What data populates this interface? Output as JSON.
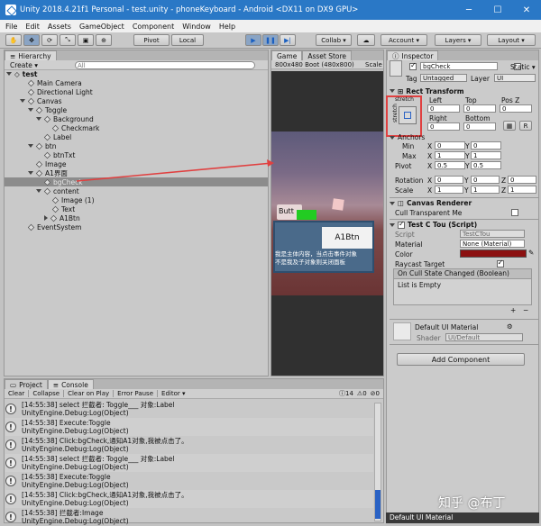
{
  "window": {
    "title": "Unity 2018.4.21f1 Personal - test.unity - phoneKeyboard - Android <DX11 on DX9 GPU>",
    "minimize": "─",
    "maximize": "☐",
    "close": "✕"
  },
  "menu": [
    "File",
    "Edit",
    "Assets",
    "GameObject",
    "Component",
    "Window",
    "Help"
  ],
  "toolbar": {
    "pivot": "Pivot",
    "local": "Local",
    "collab": "Collab ▾",
    "account": "Account ▾",
    "layers": "Layers ▾",
    "layout": "Layout ▾"
  },
  "hierarchy": {
    "tab": "Hierarchy",
    "create": "Create ▾",
    "search_placeholder": "All",
    "scene": "test",
    "items": [
      {
        "label": "Main Camera",
        "depth": 1,
        "arrow": ""
      },
      {
        "label": "Directional Light",
        "depth": 1,
        "arrow": ""
      },
      {
        "label": "Canvas",
        "depth": 1,
        "arrow": "down"
      },
      {
        "label": "Toggle",
        "depth": 2,
        "arrow": "down"
      },
      {
        "label": "Background",
        "depth": 3,
        "arrow": "down"
      },
      {
        "label": "Checkmark",
        "depth": 4,
        "arrow": ""
      },
      {
        "label": "Label",
        "depth": 3,
        "arrow": ""
      },
      {
        "label": "btn",
        "depth": 2,
        "arrow": "down"
      },
      {
        "label": "btnTxt",
        "depth": 3,
        "arrow": ""
      },
      {
        "label": "Image",
        "depth": 2,
        "arrow": ""
      },
      {
        "label": "A1界面",
        "depth": 2,
        "arrow": "down"
      },
      {
        "label": "bgCheck",
        "depth": 3,
        "arrow": "",
        "selected": true
      },
      {
        "label": "content",
        "depth": 3,
        "arrow": "down"
      },
      {
        "label": "Image (1)",
        "depth": 4,
        "arrow": ""
      },
      {
        "label": "Text",
        "depth": 4,
        "arrow": ""
      },
      {
        "label": "A1Btn",
        "depth": 4,
        "arrow": "right"
      },
      {
        "label": "EventSystem",
        "depth": 1,
        "arrow": ""
      }
    ]
  },
  "game": {
    "tab_game": "Game",
    "tab_asset": "Asset Store",
    "resolution": "800x480 Boot (480x800)",
    "scale": "Scale",
    "button_text": "Butt",
    "a1btn": "A1Btn",
    "message_line1": "我是主体内容，当点击事件对象",
    "message_line2": "不是我及子对象则关闭面板"
  },
  "inspector": {
    "tab": "Inspector",
    "object_name": "bgCheck",
    "static": "Static ▾",
    "tag_label": "Tag",
    "tag_value": "Untagged",
    "layer_label": "Layer",
    "layer_value": "UI",
    "rect": {
      "title": "Rect Transform",
      "stretch_top": "stretch",
      "stretch_side": "stretch",
      "left": "Left",
      "top": "Top",
      "posz": "Pos Z",
      "left_v": "0",
      "top_v": "0",
      "posz_v": "0",
      "right": "Right",
      "bottom": "Bottom",
      "right_v": "0",
      "bottom_v": "0",
      "r_btn": "R"
    },
    "anchors": {
      "title": "Anchors",
      "min": "Min",
      "max": "Max",
      "pivot": "Pivot",
      "x": "X",
      "y": "Y",
      "min_x": "0",
      "min_y": "0",
      "max_x": "1",
      "max_y": "1",
      "pivot_x": "0.5",
      "pivot_y": "0.5"
    },
    "rotation": {
      "label": "Rotation",
      "x": "0",
      "y": "0",
      "z": "0"
    },
    "scale": {
      "label": "Scale",
      "x": "1",
      "y": "1",
      "z": "1"
    },
    "canvas_renderer": {
      "title": "Canvas Renderer",
      "cull": "Cull Transparent Me"
    },
    "script_comp": {
      "title": "Test C Tou (Script)",
      "script_label": "Script",
      "script_value": "TestCTou",
      "material_label": "Material",
      "material_value": "None (Material)",
      "color_label": "Color",
      "raycast_label": "Raycast Target",
      "event_title": "On Cull State Changed (Boolean)",
      "list_empty": "List is Empty",
      "plus": "+",
      "minus": "−"
    },
    "material": {
      "name": "Default UI Material",
      "shader_label": "Shader",
      "shader_value": "UI/Default"
    },
    "add_component": "Add Component",
    "footer": "Default UI Material"
  },
  "console": {
    "tab_project": "Project",
    "tab_console": "Console",
    "clear": "Clear",
    "collapse": "Collapse",
    "clear_on_play": "Clear on Play",
    "error_pause": "Error Pause",
    "editor": "Editor ▾",
    "count_info": "14",
    "count_warn": "0",
    "count_err": "0",
    "logs": [
      {
        "l1": "[14:55:38] select 拦截者: Toggle___ 对象:Label",
        "l2": "UnityEngine.Debug:Log(Object)"
      },
      {
        "l1": "[14:55:38] Execute:Toggle",
        "l2": "UnityEngine.Debug:Log(Object)"
      },
      {
        "l1": "[14:55:38] Click:bgCheck,通知A1对象,我被点击了。",
        "l2": "UnityEngine.Debug:Log(Object)"
      },
      {
        "l1": "[14:55:38] select 拦截者: Toggle___ 对象:Label",
        "l2": "UnityEngine.Debug:Log(Object)"
      },
      {
        "l1": "[14:55:38] Execute:Toggle",
        "l2": "UnityEngine.Debug:Log(Object)"
      },
      {
        "l1": "[14:55:38] Click:bgCheck,通知A1对象,我被点击了。",
        "l2": "UnityEngine.Debug:Log(Object)"
      },
      {
        "l1": "[14:55:38] 拦截者:Image",
        "l2": "UnityEngine.Debug:Log(Object)"
      }
    ]
  },
  "watermark": "知乎 @布丁",
  "colors": {
    "title_bar": "#2a78c6",
    "selection": "#8c8c8c",
    "highlight_box": "#e04040",
    "green_box": "#22cc22",
    "color_swatch": "#8b1010"
  }
}
